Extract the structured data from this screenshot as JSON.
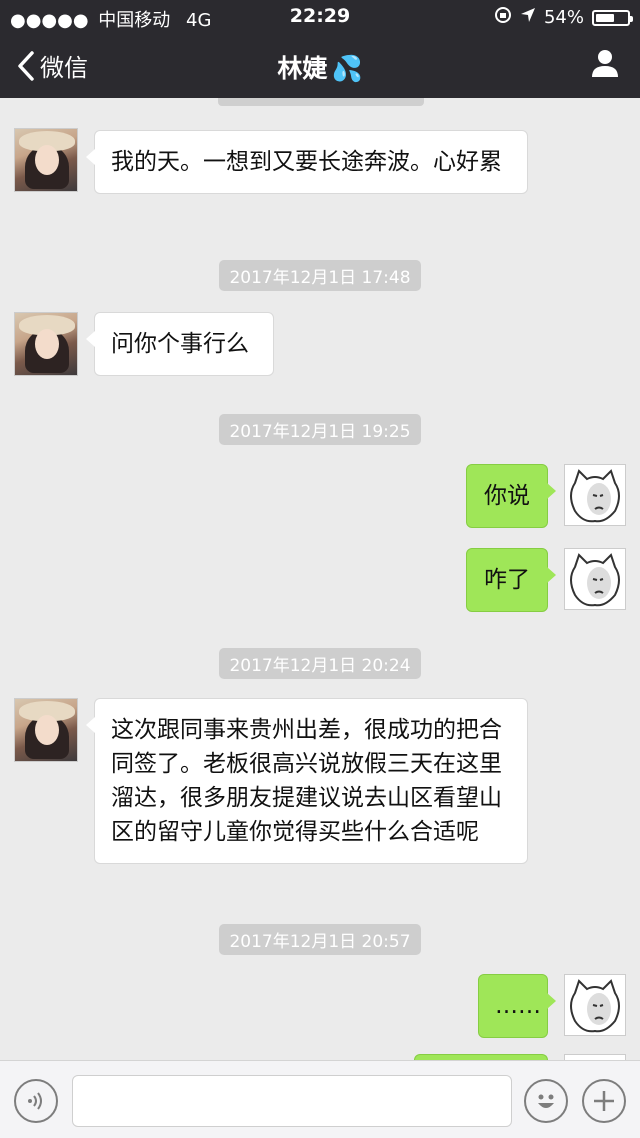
{
  "status_bar": {
    "signal": "●●●●●",
    "carrier": "中国移动",
    "network": "4G",
    "time": "22:29",
    "battery": "54%",
    "battery_level": 0.54
  },
  "nav": {
    "back_label": "微信",
    "title": "林婕",
    "title_emoji": "💦"
  },
  "messages": [
    {
      "type": "in",
      "text": "我的天。一想到又要长途奔波。心好累"
    },
    {
      "type": "time",
      "text": "2017年12月1日 17:48"
    },
    {
      "type": "in",
      "text": "问你个事行么"
    },
    {
      "type": "time",
      "text": "2017年12月1日 19:25"
    },
    {
      "type": "out",
      "text": "你说"
    },
    {
      "type": "out",
      "text": "咋了"
    },
    {
      "type": "time",
      "text": "2017年12月1日 20:24"
    },
    {
      "type": "in",
      "text": "这次跟同事来贵州出差，很成功的把合同签了。老板很高兴说放假三天在这里溜达，很多朋友提建议说去山区看望山区的留守儿童你觉得买些什么合适呢"
    },
    {
      "type": "time",
      "text": "2017年12月1日 20:57"
    },
    {
      "type": "out",
      "text": "……"
    }
  ],
  "input": {
    "placeholder": ""
  },
  "icons": {
    "back": "chevron-left-icon",
    "profile": "person-icon",
    "voice": "voice-icon",
    "emoji": "smile-icon",
    "more": "plus-icon"
  }
}
